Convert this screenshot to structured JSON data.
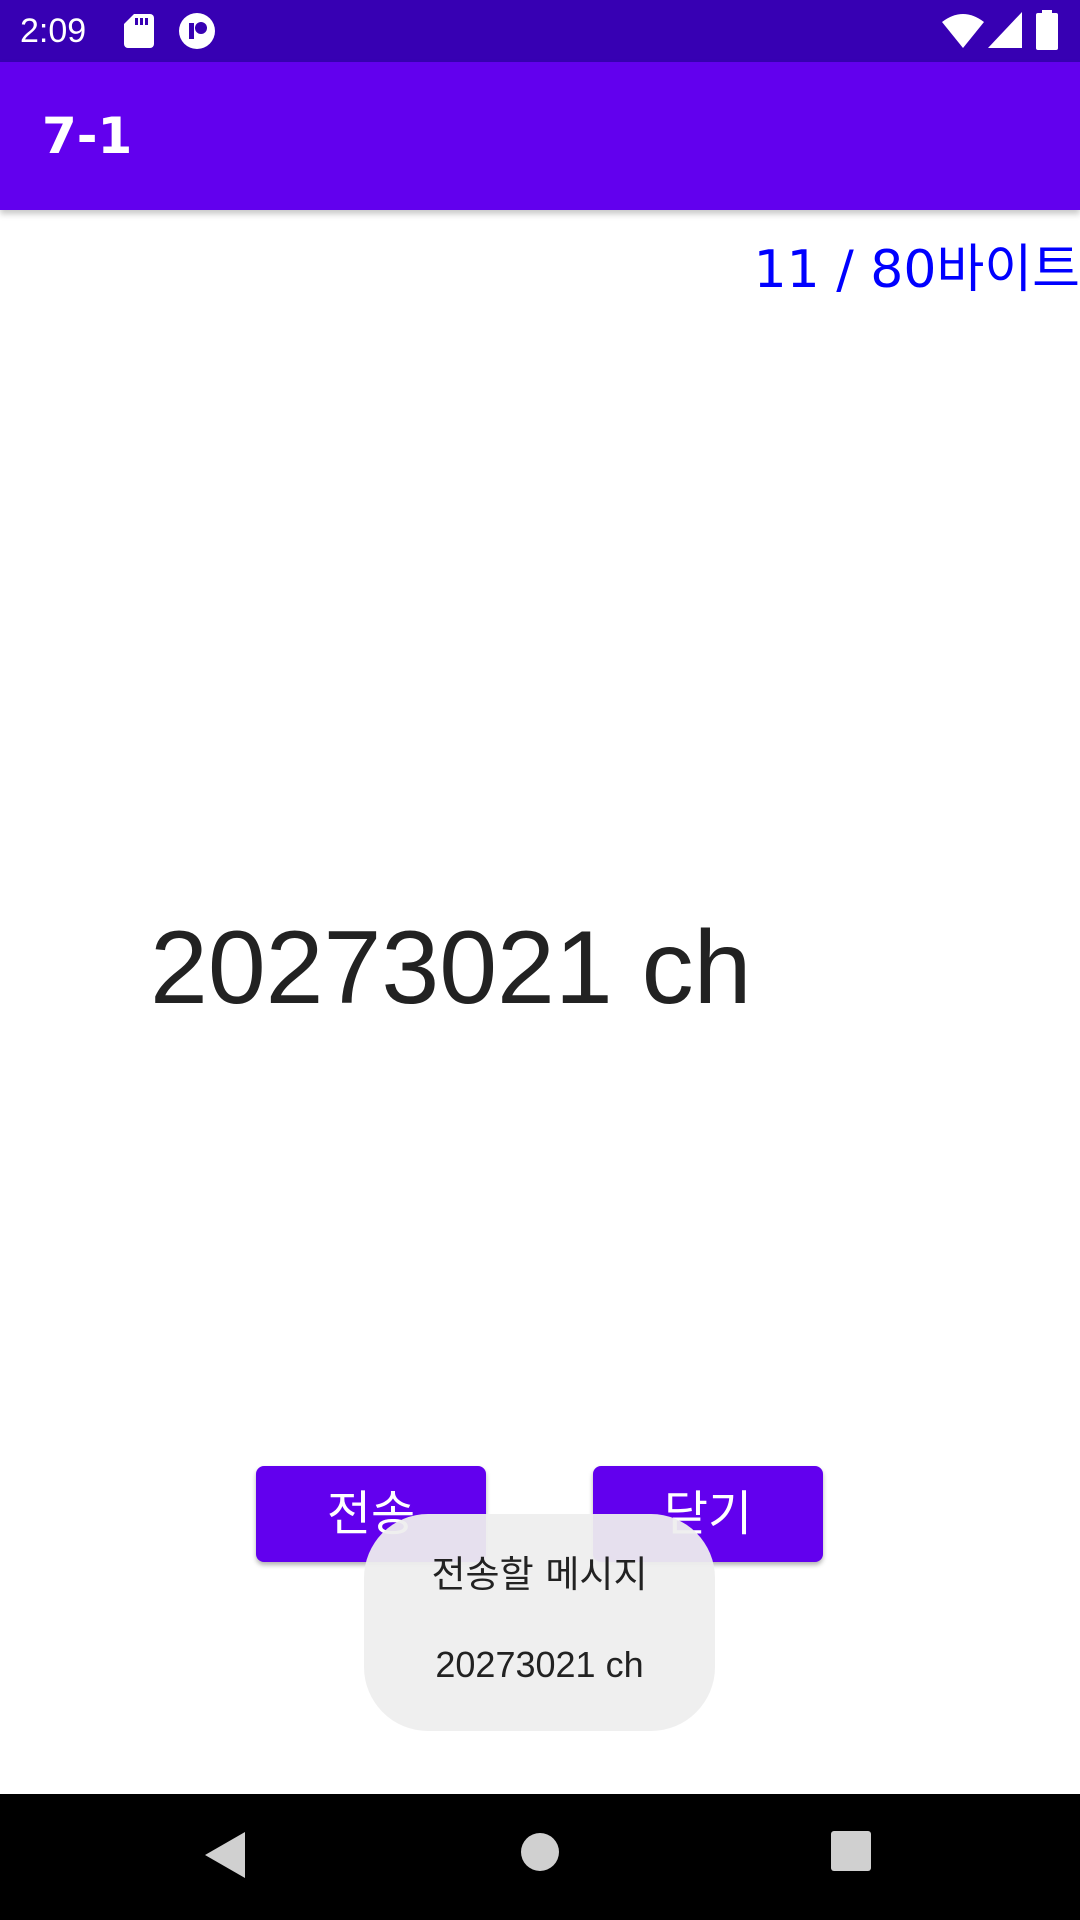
{
  "status_bar": {
    "time": "2:09",
    "left_icons": [
      "sd-card-icon",
      "app-notification-icon"
    ],
    "right_icons": [
      "wifi-icon",
      "cellular-signal-icon",
      "battery-icon"
    ],
    "background": "#3700b3"
  },
  "app_bar": {
    "title": "7-1",
    "background": "#6200ee"
  },
  "byte_counter": {
    "text": "11 / 80바이트",
    "color": "#0000ff"
  },
  "message_input": {
    "value": "20273021 ch"
  },
  "buttons": {
    "send_label": "전송",
    "close_label": "닫기",
    "color": "#6200ee"
  },
  "toast": {
    "title": "전송할 메시지",
    "body": "20273021 ch"
  },
  "nav_bar": {
    "icons": [
      "back-icon",
      "home-icon",
      "recents-icon"
    ]
  }
}
